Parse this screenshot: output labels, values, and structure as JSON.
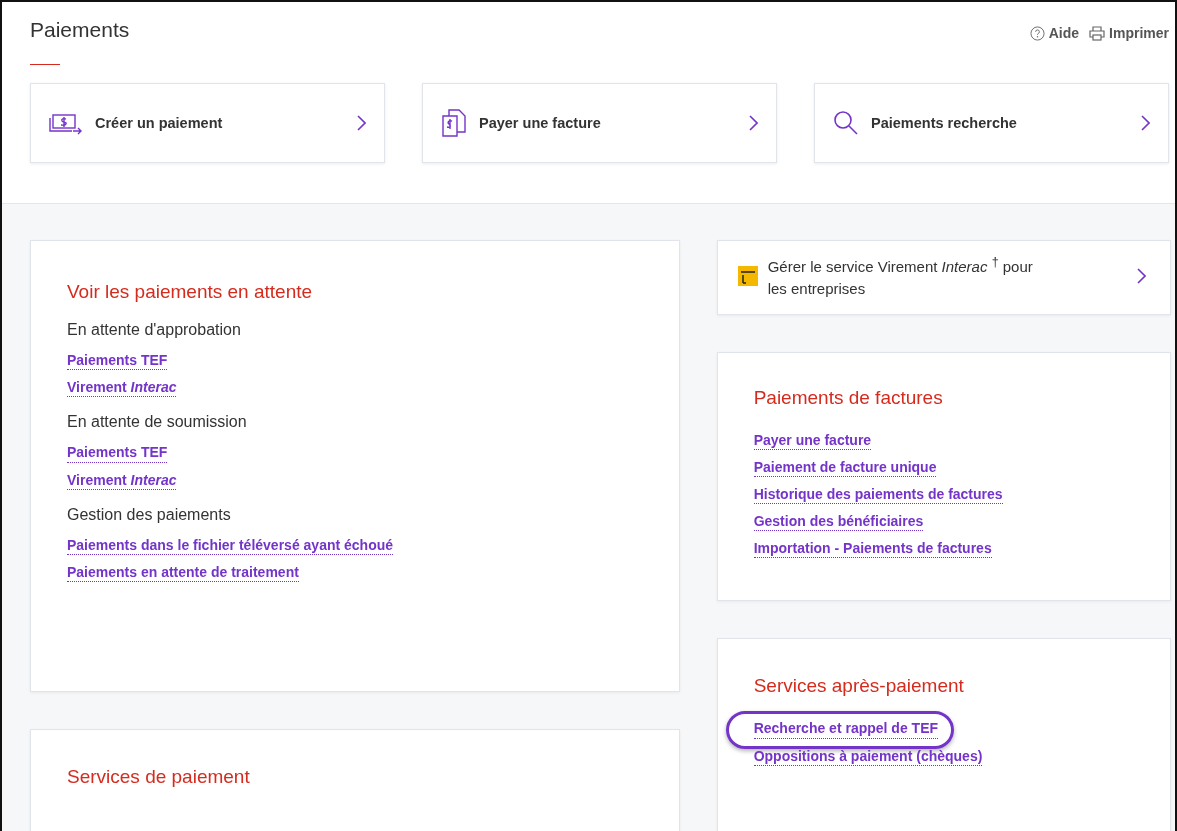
{
  "header": {
    "title": "Paiements",
    "actions": [
      {
        "kind": "help",
        "label": "Aide"
      },
      {
        "kind": "print",
        "label": "Imprimer"
      }
    ]
  },
  "quick_actions": [
    {
      "kind": "money",
      "label": "Créer un paiement"
    },
    {
      "kind": "bill",
      "label": "Payer une facture"
    },
    {
      "kind": "search",
      "label": "Paiements recherche"
    }
  ],
  "pending_card": {
    "title": "Voir les paiements en attente",
    "groups": [
      {
        "heading": "En attente d'approbation",
        "links": [
          "Paiements TEF",
          "Virement *Interac*"
        ]
      },
      {
        "heading": "En attente de soumission",
        "links": [
          "Paiements TEF",
          "Virement *Interac*"
        ]
      },
      {
        "heading": "Gestion des paiements",
        "links": [
          "Paiements dans le fichier téléversé ayant échoué",
          "Paiements en attente de traitement"
        ]
      }
    ]
  },
  "services_card": {
    "title": "Services de paiement"
  },
  "interac_card": {
    "text": "Gérer le service Virement *Interac* $^{†}$ pour les entreprises"
  },
  "bills_card": {
    "title": "Paiements de factures",
    "links": [
      {
        "label": "Payer une facture",
        "highlighted": false
      },
      {
        "label": "Paiement de facture unique",
        "highlighted": false
      },
      {
        "label": "Historique des paiements de factures",
        "highlighted": false
      },
      {
        "label": "Gestion des bénéficiaires",
        "highlighted": false
      },
      {
        "label": "Importation - Paiements de factures",
        "highlighted": false
      }
    ]
  },
  "after_payment_card": {
    "title": "Services après-paiement",
    "links": [
      {
        "label": "Recherche et rappel de TEF",
        "highlighted": true
      },
      {
        "label": "Oppositions à paiement (chèques)",
        "highlighted": false
      }
    ]
  }
}
